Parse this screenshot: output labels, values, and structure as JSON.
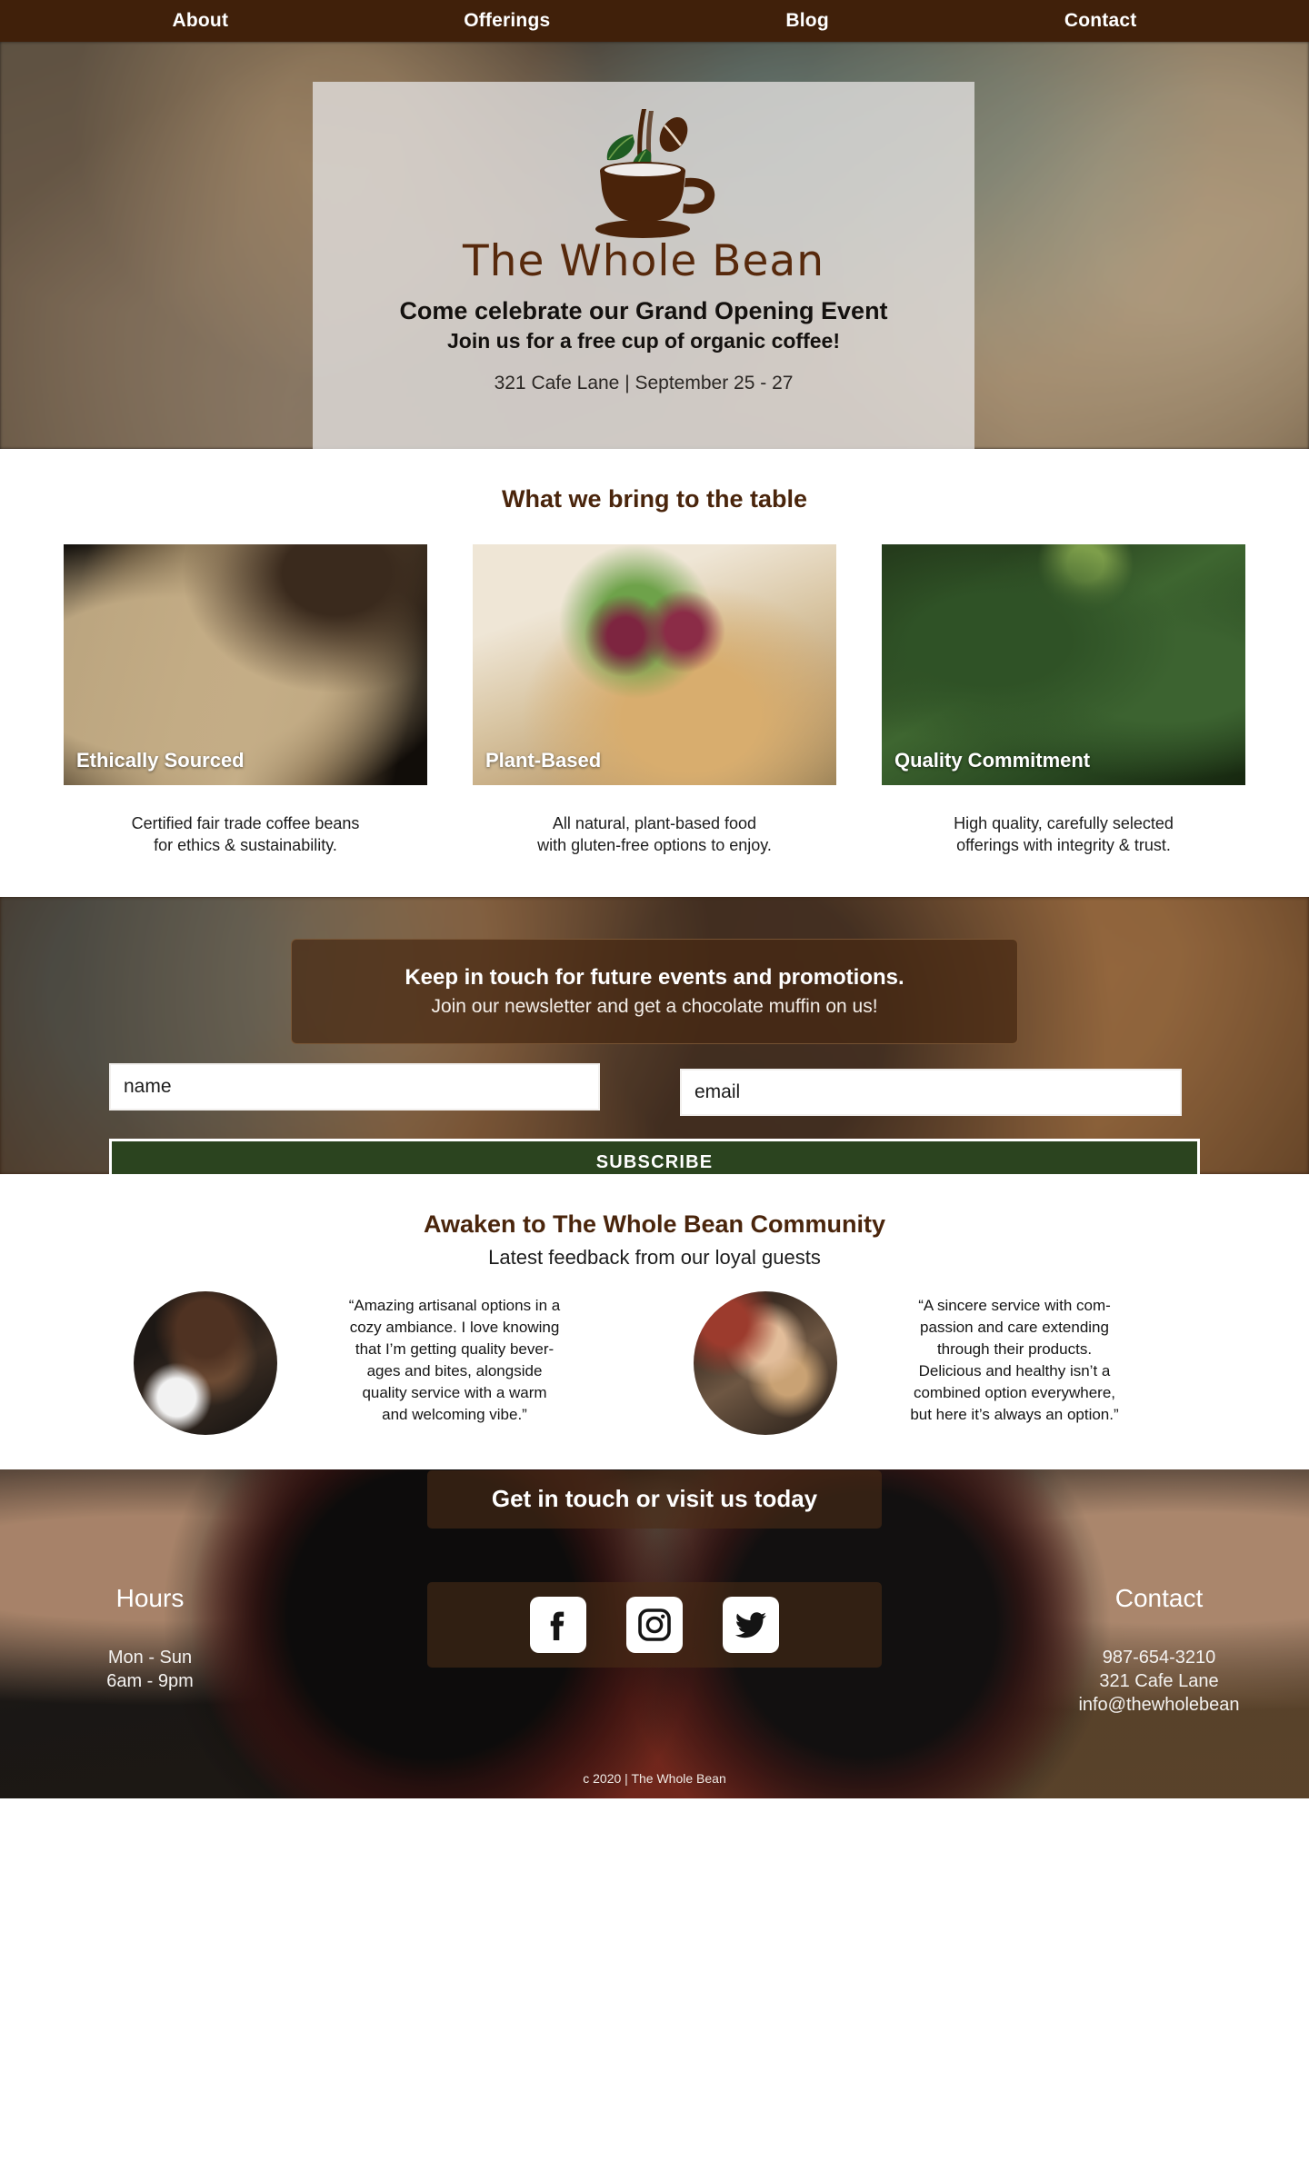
{
  "nav": {
    "items": [
      {
        "label": "About"
      },
      {
        "label": "Offerings"
      },
      {
        "label": "Blog"
      },
      {
        "label": "Contact"
      }
    ]
  },
  "hero": {
    "brand": "The Whole Bean",
    "headline": "Come celebrate our Grand Opening Event",
    "subheadline": "Join us for a free cup of organic coffee!",
    "meta": "321 Cafe Lane | September 25 - 27",
    "logo_icon": "coffee-cup-with-bean-and-leaves-icon"
  },
  "features": {
    "title": "What we bring to the table",
    "cards": [
      {
        "label": "Ethically Sourced",
        "text": "Certified fair trade coffee beans\nfor ethics & sustainability.",
        "image": "sack-of-coffee-beans-photo"
      },
      {
        "label": "Plant-Based",
        "text": "All natural, plant-based food\nwith gluten-free options to enjoy.",
        "image": "figs-and-walnuts-photo"
      },
      {
        "label": "Quality Commitment",
        "text": "High quality, carefully selected\nofferings with integrity & trust.",
        "image": "coffee-plant-branch-photo"
      }
    ]
  },
  "newsletter": {
    "headline": "Keep in touch for future events and promotions.",
    "subheadline": "Join our newsletter and get a chocolate muffin on us!",
    "name_placeholder": "name",
    "name_value": "",
    "email_placeholder": "email",
    "email_value": "",
    "submit_label": "SUBSCRIBE",
    "submit_color": "#2b441f"
  },
  "testimonials": {
    "title": "Awaken to The Whole Bean Community",
    "subtitle": "Latest feedback from our loyal guests",
    "items": [
      {
        "avatar": "customer-portrait-1",
        "quote": "“Amazing artisanal options in a\ncozy ambiance. I love knowing\nthat I’m getting quality bever-\nages and bites, alongside\nquality service with a warm\nand welcoming vibe.”"
      },
      {
        "avatar": "customer-portrait-2",
        "quote": "“A sincere service with com-\npassion and care extending\nthrough their products.\nDelicious and healthy isn’t a\ncombined option everywhere,\nbut here it’s always an option.”"
      }
    ]
  },
  "footer": {
    "title": "Get in touch or visit us today",
    "hours": {
      "heading": "Hours",
      "lines": "Mon - Sun\n6am - 9pm"
    },
    "contact": {
      "heading": "Contact",
      "lines": "987-654-3210\n321 Cafe Lane\ninfo@thewholebean"
    },
    "socials": [
      {
        "name": "facebook-icon",
        "label": "Facebook"
      },
      {
        "name": "instagram-icon",
        "label": "Instagram"
      },
      {
        "name": "twitter-icon",
        "label": "Twitter"
      }
    ],
    "copyright": "c 2020 | The Whole Bean"
  },
  "theme": {
    "nav_bg": "#40200a",
    "brand_brown": "#4a250c",
    "accent_green": "#2b441f"
  }
}
